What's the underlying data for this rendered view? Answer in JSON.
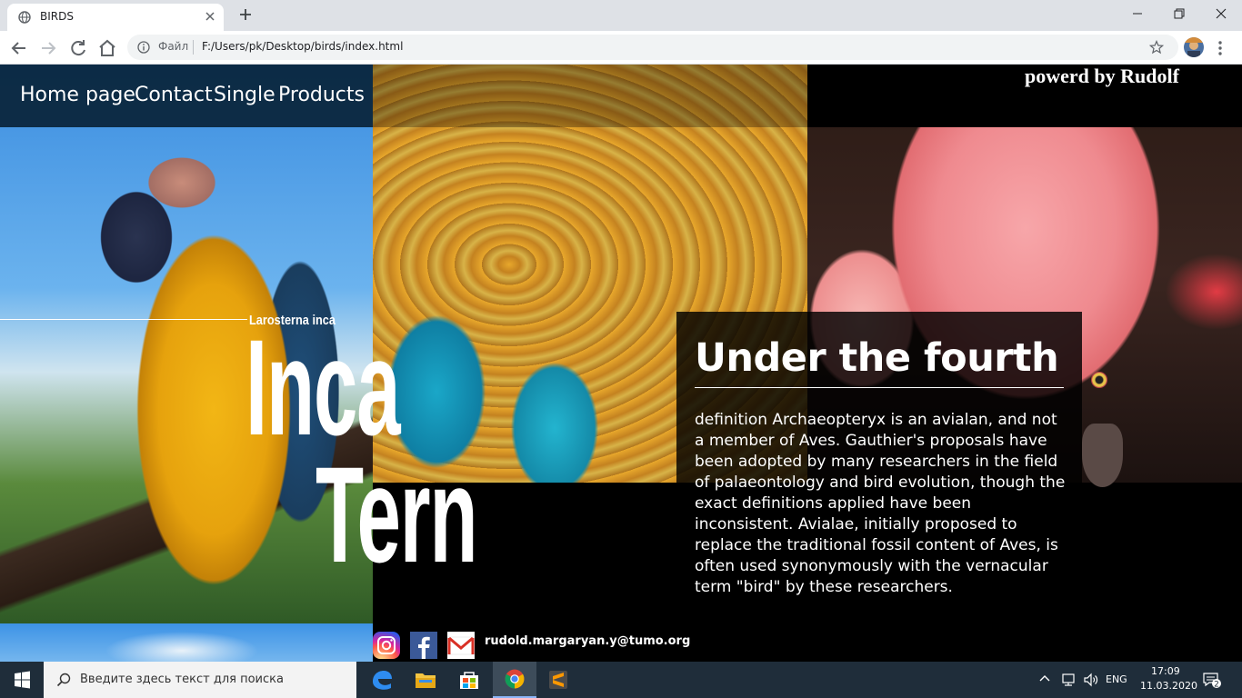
{
  "browser": {
    "tab_title": "BIRDS",
    "omnibox_label": "Файл",
    "url": "F:/Users/pk/Desktop/birds/index.html"
  },
  "page": {
    "nav": [
      "Home page",
      "Contact",
      "Single",
      "Products"
    ],
    "powered": "powerd by Rudolf",
    "hero_subtitle": "Larosterna inca",
    "hero_word1": "Inca",
    "hero_word2": "Tern",
    "card_title": "Under the fourth",
    "card_body": "definition Archaeopteryx is an avialan, and not a member of Aves. Gauthier's proposals have been adopted by many researchers in the field of palaeontology and bird evolution, though the exact definitions applied have been inconsistent. Avialae, initially proposed to replace the traditional fossil content of Aves, is often used synonymously with the vernacular term \"bird\" by these researchers.",
    "email": "rudold.margaryan.y@tumo.org",
    "social_icons": [
      "instagram-icon",
      "facebook-icon",
      "gmail-icon"
    ]
  },
  "taskbar": {
    "search_placeholder": "Введите здесь текст для поиска",
    "language": "ENG",
    "time": "17:09",
    "date": "11.03.2020",
    "notifications": "2"
  }
}
